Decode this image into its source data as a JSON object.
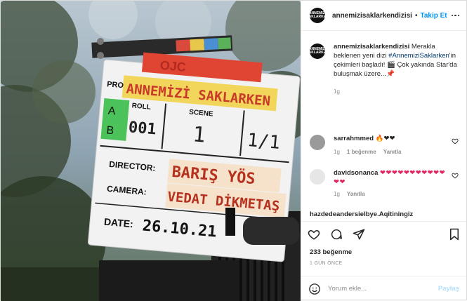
{
  "account": {
    "username": "annemizisaklarkendizisi",
    "avatar_text": "ANNEMIZI SAKLARKEN",
    "follow_label": "Takip Et"
  },
  "caption": {
    "username": "annemizisaklarkendizisi",
    "text_1": "Merakla beklenen yeni dizi",
    "hashtag": "#AnnemiziSaklarken",
    "text_2": "'in çekimleri başladı! 🎬 Çok yakında Star'da buluşmak üzere...📌",
    "time": "1g"
  },
  "comments": [
    {
      "username": "sarrahmmed",
      "text": "🔥❤❤",
      "time": "1g",
      "likes": "1 beğenme",
      "reply_label": "Yanıtla"
    },
    {
      "username": "davidsonanca",
      "text": "❤❤❤❤❤❤❤❤❤❤❤❤❤",
      "time": "1g",
      "reply_label": "Yanıtla"
    }
  ],
  "partial_comment_username": "hazdedeandersielbye.Aqitiningiz",
  "likes_count": "233 beğenme",
  "time_ago": "1 GÜN ÖNCE",
  "add_comment": {
    "placeholder": "Yorum ekle...",
    "post_label": "Paylaş"
  },
  "clapperboard": {
    "production_title": "ANNEMİZİ SAKLARKEN",
    "roll_label": "ROLL",
    "roll_value": "001",
    "scene_label": "SCENE",
    "scene_value": "1",
    "take_value": "1/1",
    "ab_label": "A\nB",
    "director_label": "DIRECTOR:",
    "director_value": "BARIŞ YÖS",
    "camera_label": "CAMERA:",
    "camera_value": "VEDAT DİKMETAŞ",
    "date_label": "DATE:",
    "date_value": "26.10.21",
    "stamp_text": "OJC",
    "prod_label": "PRO"
  }
}
